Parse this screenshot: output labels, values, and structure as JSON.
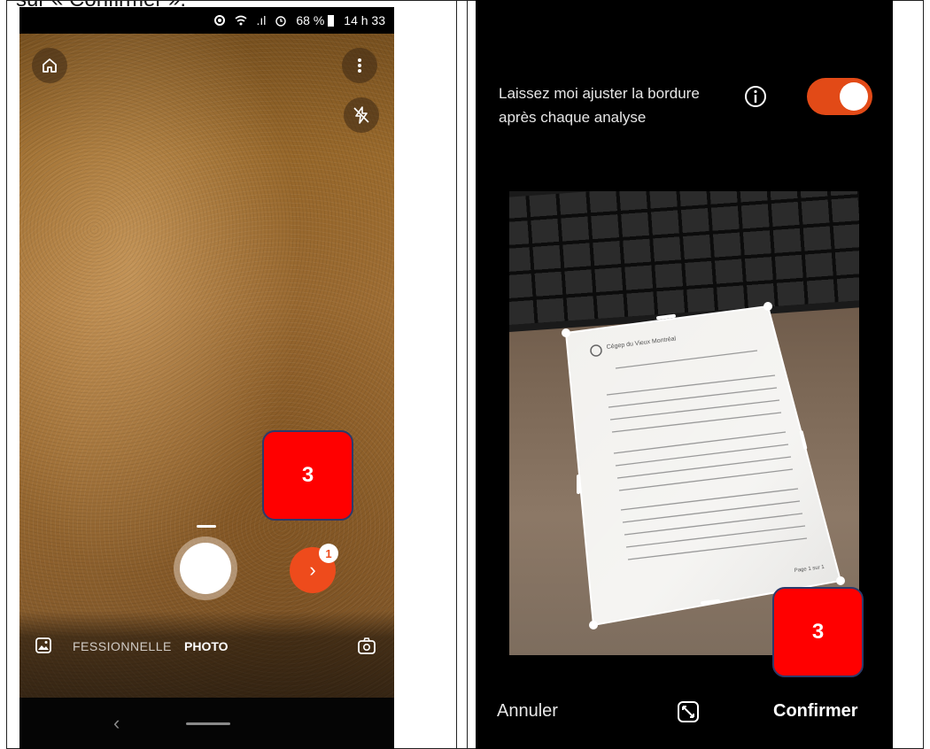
{
  "document": {
    "header_text": "sur « Confirmer ».",
    "callout_number": "3"
  },
  "left_screen": {
    "status_bar": {
      "signal_text": ".ıl",
      "battery": "68 %",
      "time": "14 h 33"
    },
    "icons": {
      "home": "home-icon",
      "more": "more-vertical-icon",
      "flash": "flash-off-icon",
      "gallery": "gallery-icon",
      "switch_camera": "switch-camera-icon"
    },
    "modes": {
      "professional": "FESSIONNELLE",
      "photo": "PHOTO"
    },
    "next_badge": "1",
    "next_glyph": "›",
    "nav_back": "‹"
  },
  "right_screen": {
    "adjust_label": "Laissez moi ajuster la bordure après chaque analyse",
    "toggle_on": true,
    "cancel_label": "Annuler",
    "confirm_label": "Confirmer",
    "paper_lines": {
      "brand": "Cégep du Vieux Montréal",
      "footer": "Page 1 sur 1"
    }
  },
  "colors": {
    "accent_orange": "#ee4b1c",
    "callout_red": "#ff0000",
    "callout_border": "#2d3a6a"
  }
}
